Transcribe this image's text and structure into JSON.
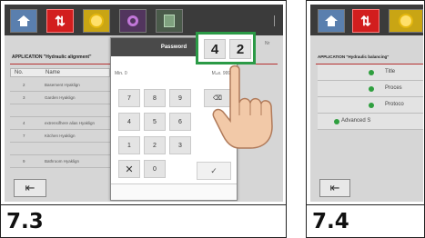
{
  "left_panel": {
    "caption": "7.3",
    "app_title": "APPLICATION \"Hydraulic alignment\"",
    "table": {
      "col_no": "No.",
      "col_name": "Name",
      "rows": [
        {
          "no": "2",
          "name": "Basement Hyaklign"
        },
        {
          "no": "3",
          "name": "Garden Hyaklign"
        },
        {
          "no": "",
          "name": ""
        },
        {
          "no": "4",
          "name": "extrensifhere alias Hyaklign"
        },
        {
          "no": "7",
          "name": "Kitchen Hyaklign"
        },
        {
          "no": "",
          "name": ""
        },
        {
          "no": "9",
          "name": "Bathroom Hyaklign"
        }
      ]
    },
    "back_icon": "exit-arrow-icon",
    "dialog": {
      "title": "Password",
      "min_label": "Min. 0",
      "max_label": "Max. 9999",
      "keys": [
        "7",
        "8",
        "9",
        "⌫",
        "4",
        "5",
        "6",
        "1",
        "2",
        "3",
        "✕",
        "0",
        "✓"
      ],
      "zoom_digits": [
        "4",
        "2"
      ]
    },
    "side_tag": "Nr"
  },
  "right_panel": {
    "caption": "7.4",
    "app_title": "APPLICATION \"Hydraulic balancing\"",
    "rows": [
      {
        "label": "Title"
      },
      {
        "label": "Proces"
      },
      {
        "label": "Protoco"
      },
      {
        "label": "Advanced S"
      }
    ],
    "status_color": "#2f9f3f"
  },
  "colors": {
    "accent_red": "#d21e1e",
    "callout_green": "#2b9a46"
  }
}
